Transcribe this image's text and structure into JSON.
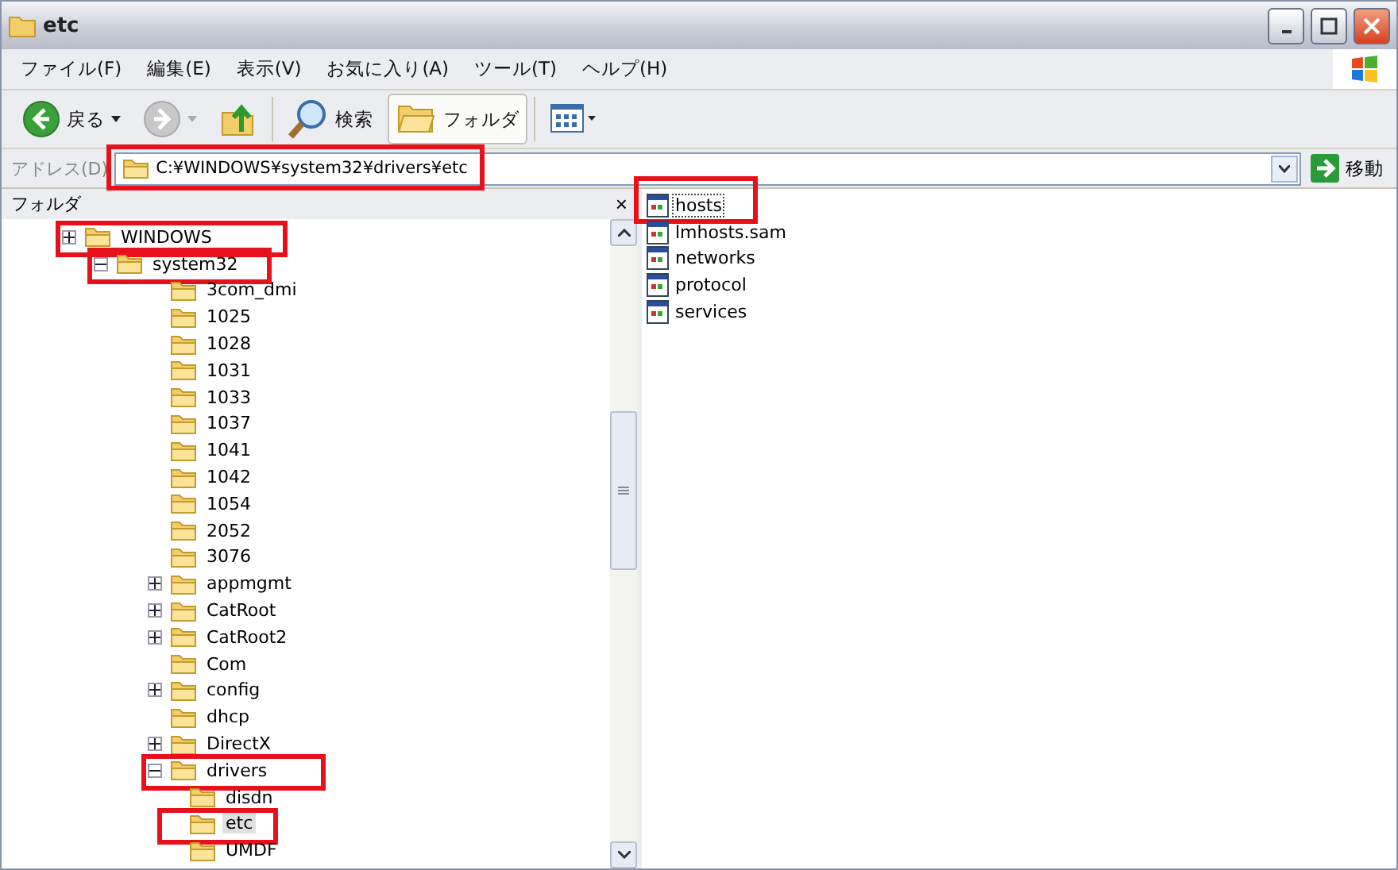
{
  "window": {
    "title": "etc"
  },
  "menu": [
    "ファイル(F)",
    "編集(E)",
    "表示(V)",
    "お気に入り(A)",
    "ツール(T)",
    "ヘルプ(H)"
  ],
  "toolbar": [
    {
      "kind": "back",
      "label": "戻る",
      "disabled": false
    },
    {
      "kind": "forward",
      "disabled": true
    },
    {
      "kind": "up"
    },
    {
      "kind": "search",
      "label": "検索"
    },
    {
      "kind": "folders",
      "label": "フォルダ",
      "selected": true
    },
    {
      "kind": "views"
    }
  ],
  "address": {
    "label": "アドレス(D)",
    "value": "C:¥WINDOWS¥system32¥drivers¥etc",
    "highlighted": true,
    "go": "移動"
  },
  "folder_pane": {
    "title": "フォルダ",
    "close": "×"
  },
  "tree": [
    {
      "name": "WINDOWS",
      "expanded": false,
      "highlighted": true,
      "selected": false,
      "children": [
        {
          "name": "system32",
          "expanded": true,
          "highlighted": true,
          "selected": false,
          "children": [
            {
              "name": "3com_dmi",
              "selected": false
            },
            {
              "name": "1025",
              "selected": false
            },
            {
              "name": "1028",
              "selected": false
            },
            {
              "name": "1031",
              "selected": false
            },
            {
              "name": "1033",
              "selected": false
            },
            {
              "name": "1037",
              "selected": false
            },
            {
              "name": "1041",
              "selected": false
            },
            {
              "name": "1042",
              "selected": false
            },
            {
              "name": "1054",
              "selected": false
            },
            {
              "name": "2052",
              "selected": false
            },
            {
              "name": "3076",
              "selected": false
            },
            {
              "name": "appmgmt",
              "expanded": false,
              "selected": false
            },
            {
              "name": "CatRoot",
              "expanded": false,
              "selected": false
            },
            {
              "name": "CatRoot2",
              "expanded": false,
              "selected": false
            },
            {
              "name": "Com",
              "selected": false
            },
            {
              "name": "config",
              "expanded": false,
              "selected": false
            },
            {
              "name": "dhcp",
              "selected": false
            },
            {
              "name": "DirectX",
              "expanded": false,
              "selected": false
            },
            {
              "name": "drivers",
              "expanded": true,
              "highlighted": true,
              "selected": false,
              "children": [
                {
                  "name": "disdn",
                  "selected": false
                },
                {
                  "name": "etc",
                  "highlighted": true,
                  "selected": true
                },
                {
                  "name": "UMDF",
                  "selected": false
                }
              ]
            }
          ]
        }
      ]
    }
  ],
  "files": [
    {
      "name": "hosts",
      "selected": true,
      "highlighted": true
    },
    {
      "name": "lmhosts.sam",
      "selected": false
    },
    {
      "name": "networks",
      "selected": false
    },
    {
      "name": "protocol",
      "selected": false
    },
    {
      "name": "services",
      "selected": false
    }
  ]
}
